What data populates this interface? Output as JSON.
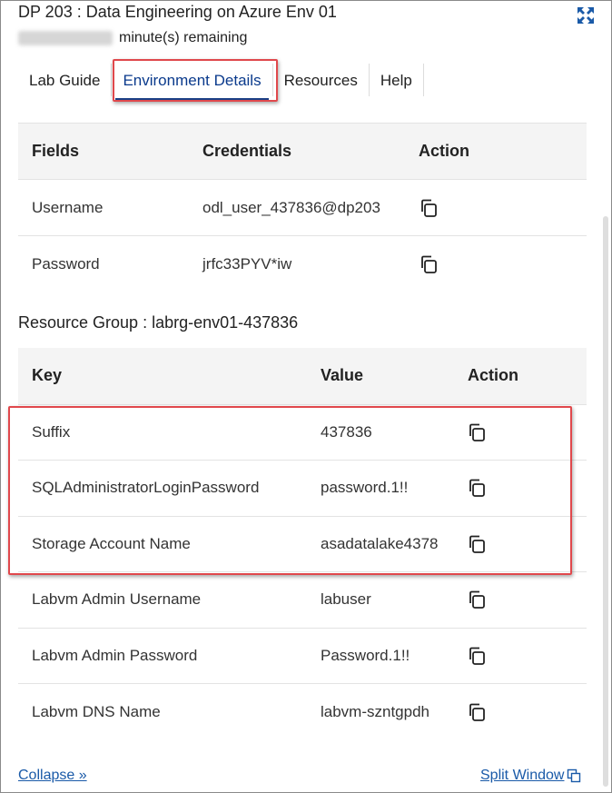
{
  "header": {
    "title": "DP 203 : Data Engineering on Azure Env 01",
    "timer_suffix": "minute(s) remaining",
    "expand_icon": "expand-arrows-icon"
  },
  "tabs": [
    {
      "label": "Lab Guide",
      "active": false
    },
    {
      "label": "Environment Details",
      "active": true
    },
    {
      "label": "Resources",
      "active": false
    },
    {
      "label": "Help",
      "active": false
    }
  ],
  "credentials_table": {
    "headers": [
      "Fields",
      "Credentials",
      "Action"
    ],
    "rows": [
      {
        "field": "Username",
        "value": "odl_user_437836@dp203"
      },
      {
        "field": "Password",
        "value": "jrfc33PYV*iw"
      }
    ]
  },
  "resource_group": {
    "label": "Resource Group : labrg-env01-437836"
  },
  "resource_table": {
    "headers": [
      "Key",
      "Value",
      "Action"
    ],
    "rows": [
      {
        "key": "Suffix",
        "value": "437836"
      },
      {
        "key": "SQLAdministratorLoginPassword",
        "value": "password.1!!"
      },
      {
        "key": "Storage Account Name",
        "value": "asadatalake4378"
      },
      {
        "key": "Labvm Admin Username",
        "value": "labuser"
      },
      {
        "key": "Labvm Admin Password",
        "value": "Password.1!!"
      },
      {
        "key": "Labvm DNS Name",
        "value": "labvm-szntgpdh"
      }
    ]
  },
  "footer": {
    "collapse": "Collapse »",
    "split_window": "Split Window"
  },
  "colors": {
    "highlight": "#e0484c",
    "link": "#1a5aa8",
    "active_tab": "#0a3a8c"
  }
}
